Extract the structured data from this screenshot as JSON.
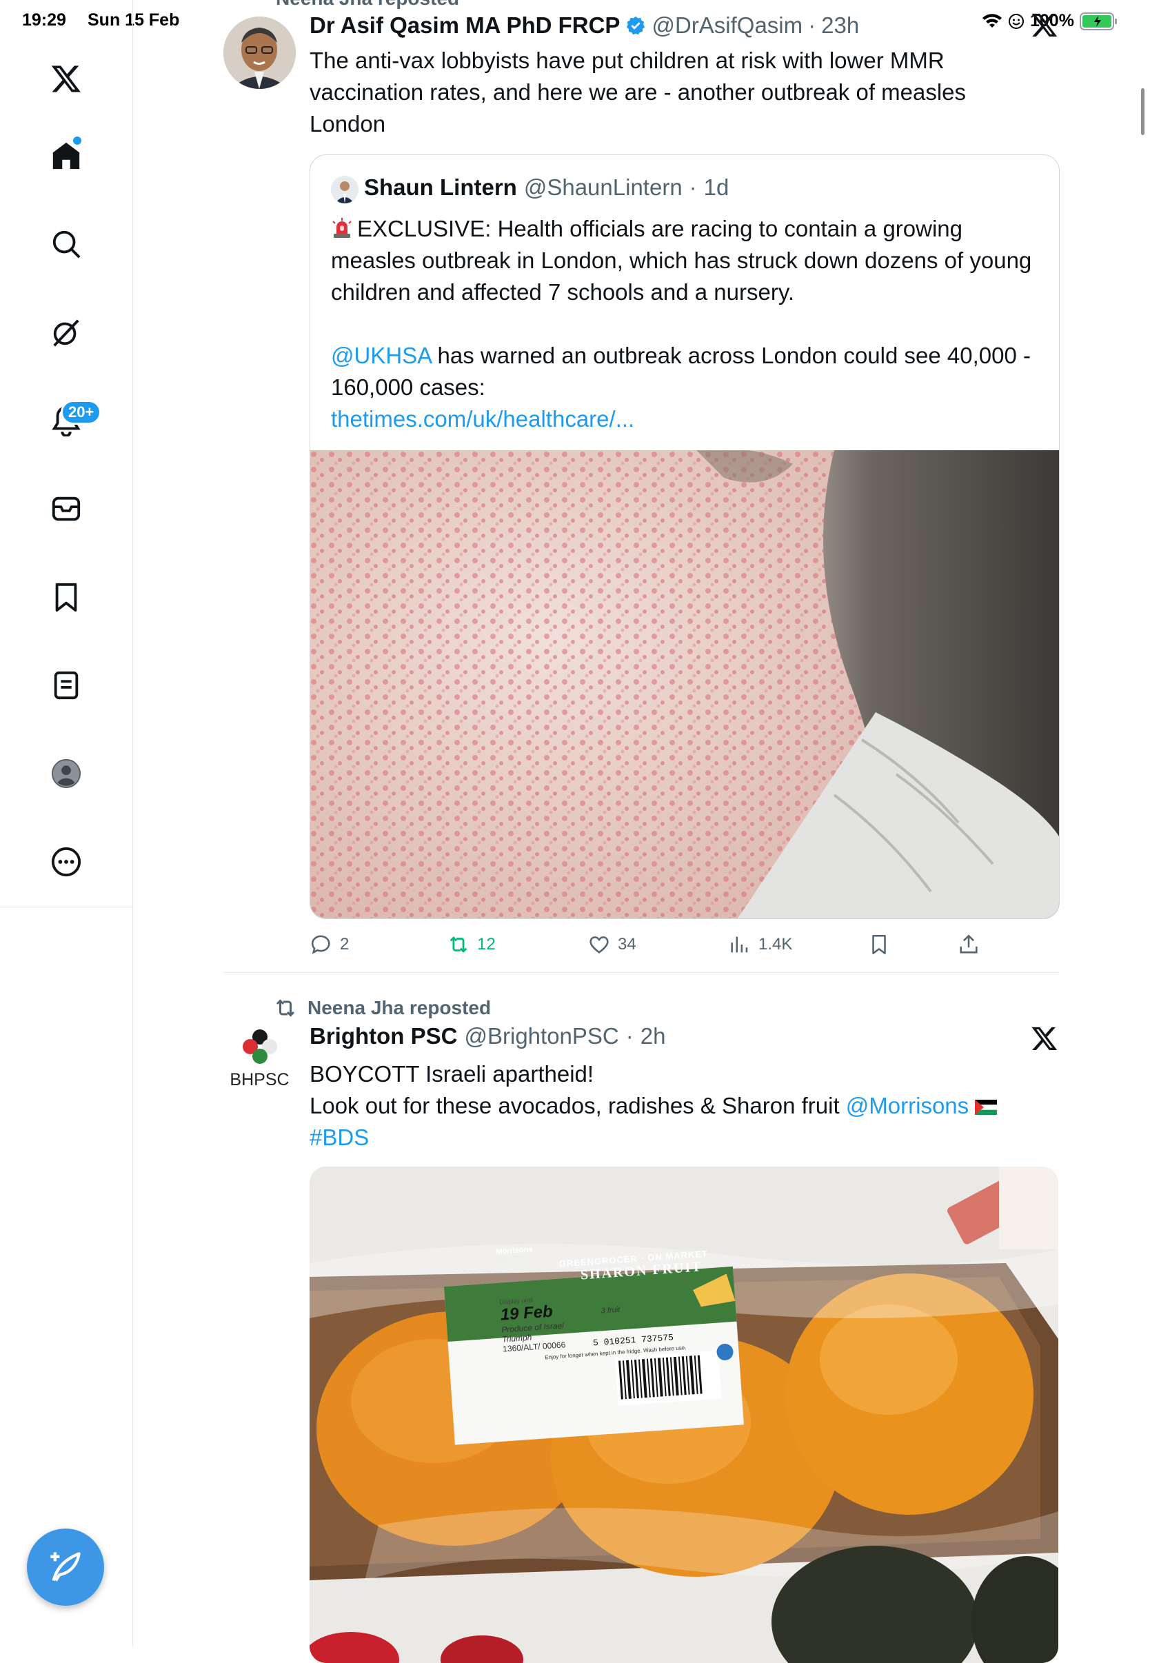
{
  "status_bar": {
    "time": "19:29",
    "date": "Sun 15 Feb",
    "battery": "100%"
  },
  "sidebar": {
    "items": [
      {
        "name": "x-logo-icon"
      },
      {
        "name": "home-icon"
      },
      {
        "name": "search-icon"
      },
      {
        "name": "grok-icon"
      },
      {
        "name": "notifications-icon"
      },
      {
        "name": "messages-icon"
      },
      {
        "name": "bookmarks-icon"
      },
      {
        "name": "lists-icon"
      },
      {
        "name": "profile-icon"
      },
      {
        "name": "more-icon"
      }
    ],
    "notification_badge": "20+"
  },
  "top_repost": {
    "label": "Neena Jha reposted"
  },
  "tweet1": {
    "author_name": "Dr Asif Qasim MA PhD FRCP",
    "handle": "@DrAsifQasim",
    "time": "23h",
    "text": "The anti-vax lobbyists have put children at risk with lower MMR vaccination rates, and here we are - another outbreak of measles London",
    "quote": {
      "author_name": "Shaun Lintern",
      "handle": "@ShaunLintern",
      "time": "1d",
      "text1": "EXCLUSIVE: Health officials are racing to contain a growing measles outbreak in London, which has struck down dozens of young children and affected 7 schools and a nursery.",
      "mention": "@UKHSA",
      "text2": "has warned an outbreak across London could see 40,000 - 160,000 cases:",
      "link": "thetimes.com/uk/healthcare/..."
    },
    "actions": {
      "replies": "2",
      "reposts": "12",
      "likes": "34",
      "views": "1.4K"
    }
  },
  "tweet2": {
    "repost_label": "Neena Jha reposted",
    "author_name": "Brighton PSC",
    "avatar_text": "BHPSC",
    "handle": "@BrightonPSC",
    "time": "2h",
    "line1": "BOYCOTT Israeli apartheid!",
    "line2": "Look out for these avocados, radishes & Sharon fruit",
    "mention": "@Morrisons",
    "hashtag": "#BDS",
    "photo_label": {
      "brand": "Morrisons",
      "since": "Since 1899",
      "market": "GREENGROCER · ON MARKET",
      "product": "SHARON FRUIT",
      "display_until": "Display until",
      "date": "19 Feb",
      "count": "3 fruit",
      "origin": "Produce of Israel",
      "variety": "Triumph",
      "code": "1360/ALT/ 00066",
      "barcode": "5 010251 737575",
      "footer": "Enjoy for longer when kept in the fridge. Wash before use."
    }
  }
}
